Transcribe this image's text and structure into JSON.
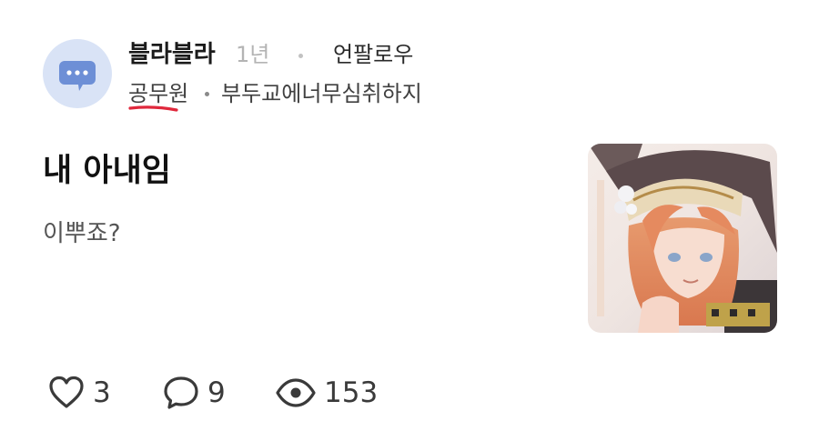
{
  "author": {
    "name": "블라블라",
    "age": "1년",
    "follow_label": "언팔로우",
    "job": "공무원",
    "company": "부두교에너무심취하지"
  },
  "post": {
    "title": "내 아내임",
    "body": "이뿌죠?"
  },
  "stats": {
    "likes": "3",
    "comments": "9",
    "views": "153"
  },
  "colors": {
    "avatar_bg": "#d9e3f6",
    "avatar_icon": "#6d8fd6",
    "underline_annotation": "#e0283c",
    "muted_text": "#b4b4b4"
  },
  "icons": {
    "avatar": "chat-bubble-dots-icon",
    "likes": "heart-icon",
    "comments": "comment-bubble-icon",
    "views": "eye-icon"
  }
}
